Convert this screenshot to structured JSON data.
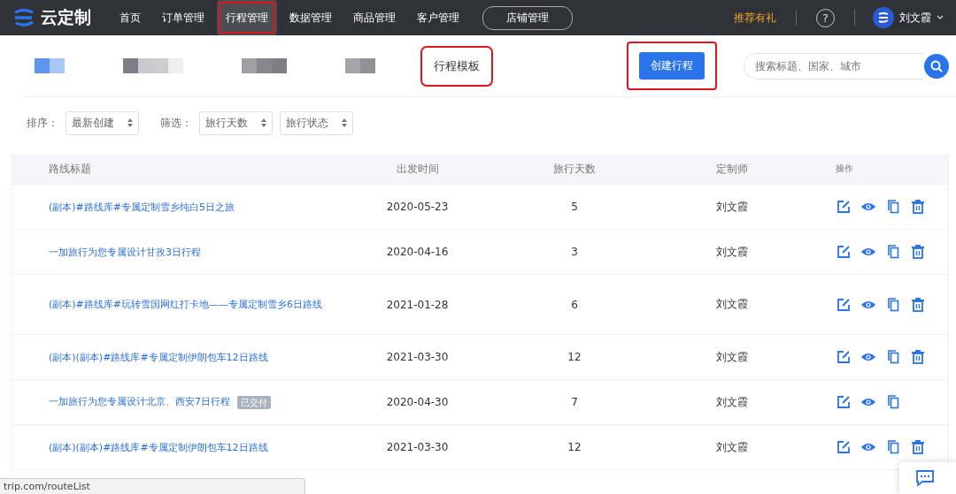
{
  "nav": {
    "logo": "云定制",
    "items": [
      {
        "label": "首页",
        "selected": false,
        "highlighted": false,
        "kind": "link"
      },
      {
        "label": "订单管理",
        "selected": false,
        "highlighted": false,
        "kind": "link"
      },
      {
        "label": "行程管理",
        "selected": true,
        "highlighted": true,
        "kind": "link"
      },
      {
        "label": "数据管理",
        "selected": false,
        "highlighted": false,
        "kind": "link"
      },
      {
        "label": "商品管理",
        "selected": false,
        "highlighted": false,
        "kind": "link"
      },
      {
        "label": "客户管理",
        "selected": false,
        "highlighted": false,
        "kind": "link"
      },
      {
        "label": "店铺管理",
        "selected": false,
        "highlighted": false,
        "kind": "pill"
      }
    ],
    "promo": "推荐有礼",
    "help": "?",
    "user": "刘文霞"
  },
  "tabs": [
    {
      "kind": "redacted",
      "highlighted": false
    },
    {
      "kind": "redacted",
      "highlighted": false
    },
    {
      "kind": "redacted",
      "highlighted": false
    },
    {
      "kind": "redacted",
      "highlighted": false
    },
    {
      "kind": "text",
      "label": "行程模板",
      "highlighted": true
    }
  ],
  "create_button": {
    "label": "创建行程",
    "highlighted": true
  },
  "search": {
    "placeholder": "搜索标题、国家、城市"
  },
  "filters": [
    {
      "label": "排序：",
      "value": "最新创建"
    },
    {
      "label": "筛选：",
      "value": "旅行天数"
    },
    {
      "value": "旅行状态"
    }
  ],
  "table": {
    "columns": [
      "路线标题",
      "出发时间",
      "旅行天数",
      "定制师",
      "操作"
    ],
    "rows": [
      {
        "title": "(副本)#路线库#专属定制雪乡纯白5日之旅",
        "date": "2020-05-23",
        "days": "5",
        "designer": "刘文霞",
        "deletable": true
      },
      {
        "title": "一加旅行为您专属设计甘孜3日行程",
        "date": "2020-04-16",
        "days": "3",
        "designer": "刘文霞",
        "deletable": true
      },
      {
        "title": "(副本)#路线库#玩转雪国网红打卡地——专属定制雪乡6日路线",
        "date": "2021-01-28",
        "days": "6",
        "designer": "刘文霞",
        "deletable": true
      },
      {
        "title": "(副本)(副本)#路线库#专属定制伊朗包车12日路线",
        "date": "2021-03-30",
        "days": "12",
        "designer": "刘文霞",
        "deletable": true
      },
      {
        "title": "一加旅行为您专属设计北京、西安7日行程",
        "badge": "已交付",
        "date": "2020-04-30",
        "days": "7",
        "designer": "刘文霞",
        "deletable": false
      },
      {
        "title": "(副本)(副本)#路线库#专属定制伊朗包车12日路线",
        "date": "2021-03-30",
        "days": "12",
        "designer": "刘文霞",
        "deletable": true
      }
    ]
  },
  "status_url": "trip.com/routeList"
}
